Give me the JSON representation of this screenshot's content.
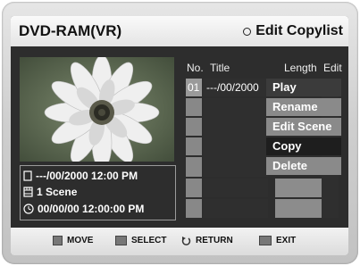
{
  "title_bar": {
    "disc": "DVD-RAM(VR)",
    "menu": "Edit Copylist"
  },
  "list": {
    "headers": {
      "no": "No.",
      "title": "Title",
      "length": "Length",
      "edit": "Edit"
    },
    "rows": [
      {
        "no": "01",
        "title": "---/00/2000"
      }
    ]
  },
  "popup_menu": {
    "items": [
      "Play",
      "Rename",
      "Edit Scene",
      "Copy",
      "Delete"
    ],
    "selected": "Copy"
  },
  "info": {
    "date": "---/00/2000 12:00 PM",
    "scenes": "1 Scene",
    "time": "00/00/00 12:00:00 PM"
  },
  "footer": {
    "move": "MOVE",
    "select": "SELECT",
    "return": "RETURN",
    "exit": "EXIT"
  },
  "icons": [
    "radio-circle-icon",
    "page-icon",
    "film-icon",
    "clock-icon",
    "updown-key-icon",
    "enter-key-icon",
    "return-key-icon",
    "menu-key-icon"
  ]
}
